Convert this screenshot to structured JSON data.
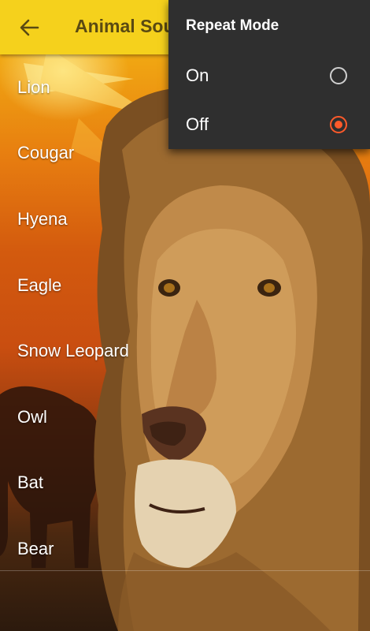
{
  "toolbar": {
    "title": "Animal Sounds",
    "back_icon": "arrow-left-icon",
    "background_color": "#f5d11c"
  },
  "animals": [
    {
      "label": "Lion"
    },
    {
      "label": "Cougar"
    },
    {
      "label": "Hyena"
    },
    {
      "label": "Eagle"
    },
    {
      "label": "Snow Leopard"
    },
    {
      "label": "Owl"
    },
    {
      "label": "Bat"
    },
    {
      "label": "Bear"
    }
  ],
  "repeat_menu": {
    "title": "Repeat Mode",
    "options": [
      {
        "label": "On",
        "selected": false
      },
      {
        "label": "Off",
        "selected": true
      }
    ],
    "accent_color": "#ff5a2a",
    "background_color": "#2f2f2f"
  }
}
